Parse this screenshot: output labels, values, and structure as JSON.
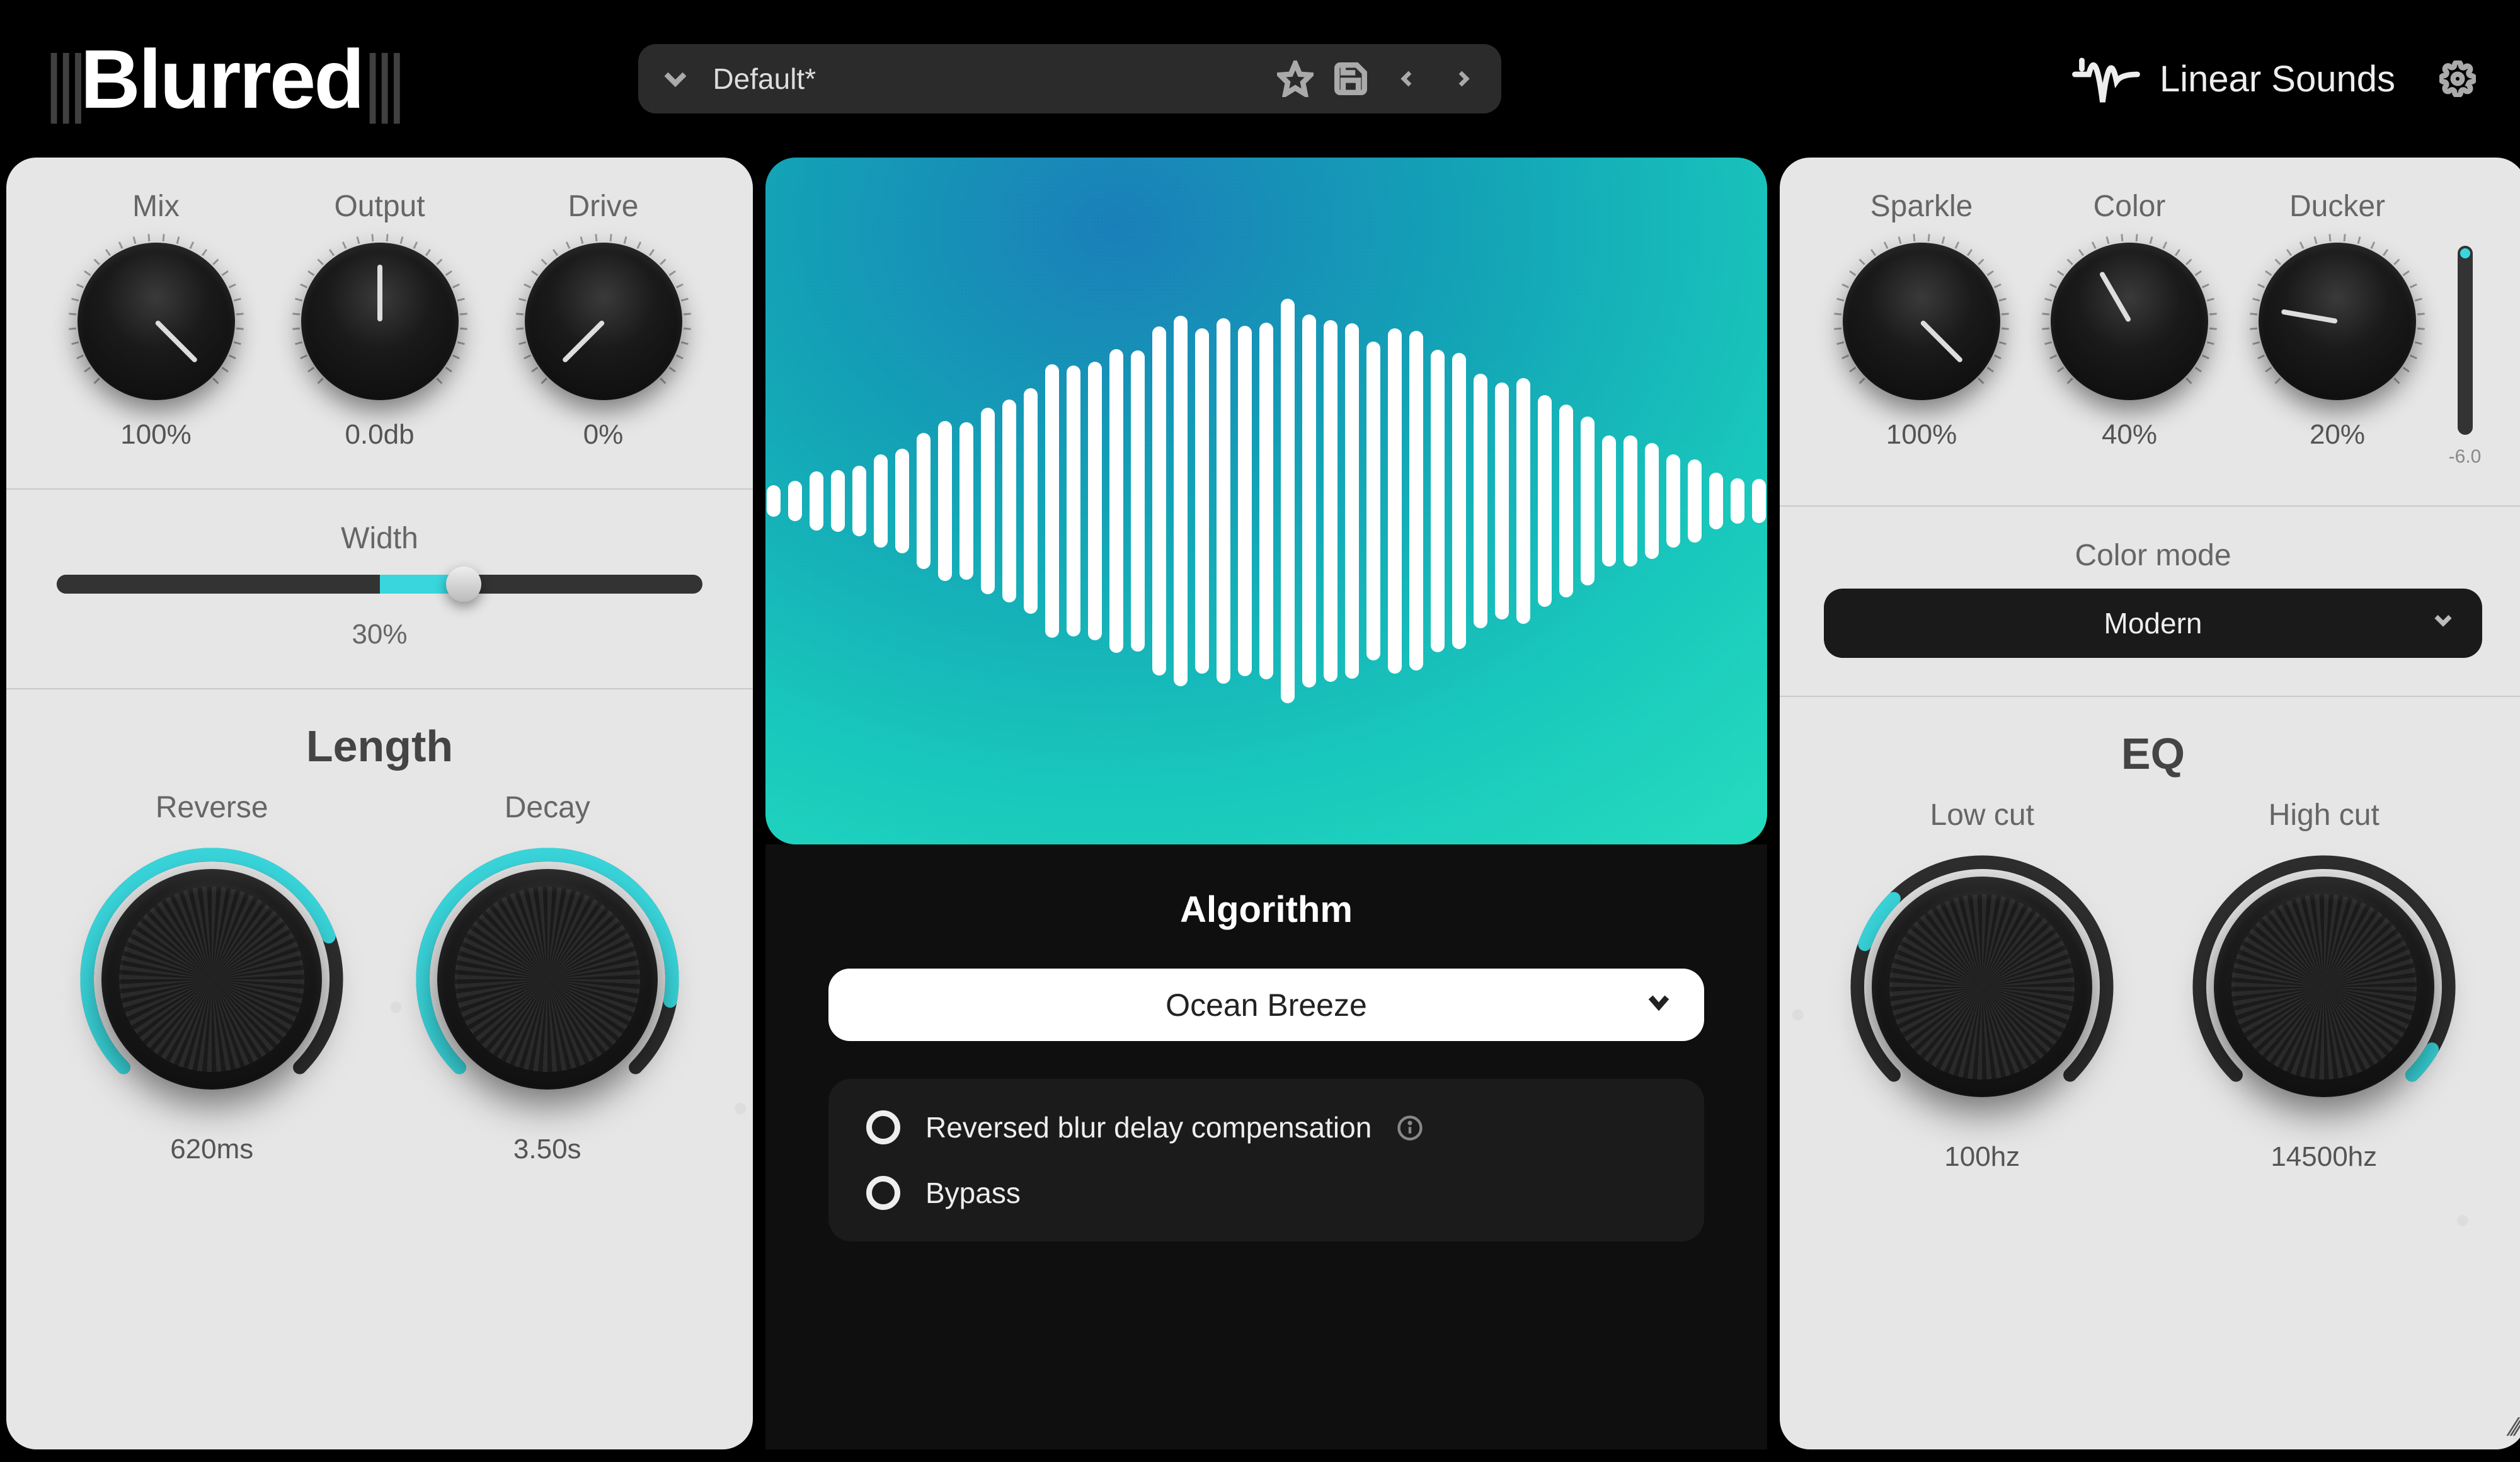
{
  "header": {
    "logo": "Blurred",
    "preset_name": "Default*",
    "brand_name": "Linear Sounds"
  },
  "left": {
    "mix": {
      "label": "Mix",
      "value": "100%",
      "angle": 135
    },
    "output": {
      "label": "Output",
      "value": "0.0db",
      "angle": 0
    },
    "drive": {
      "label": "Drive",
      "value": "0%",
      "angle": -135
    },
    "width": {
      "label": "Width",
      "value": "30%",
      "pct": 63
    },
    "length_title": "Length",
    "reverse": {
      "label": "Reverse",
      "value": "620ms",
      "arc_start": -225,
      "arc_end": -20
    },
    "decay": {
      "label": "Decay",
      "value": "3.50s",
      "arc_start": -225,
      "arc_end": 10
    }
  },
  "center": {
    "algo_title": "Algorithm",
    "algo_value": "Ocean Breeze",
    "toggle1": "Reversed blur delay compensation",
    "toggle2": "Bypass"
  },
  "right": {
    "sparkle": {
      "label": "Sparkle",
      "value": "100%",
      "angle": 135
    },
    "color": {
      "label": "Color",
      "value": "40%",
      "angle": -30
    },
    "ducker": {
      "label": "Ducker",
      "value": "20%",
      "angle": -80
    },
    "meter_label": "-6.0",
    "color_mode_label": "Color mode",
    "color_mode_value": "Modern",
    "eq_title": "EQ",
    "lowcut": {
      "label": "Low cut",
      "value": "100hz",
      "arc_start": 200,
      "arc_end": 225
    },
    "highcut": {
      "label": "High cut",
      "value": "14500hz",
      "arc_start": 30,
      "arc_end": 45
    }
  }
}
